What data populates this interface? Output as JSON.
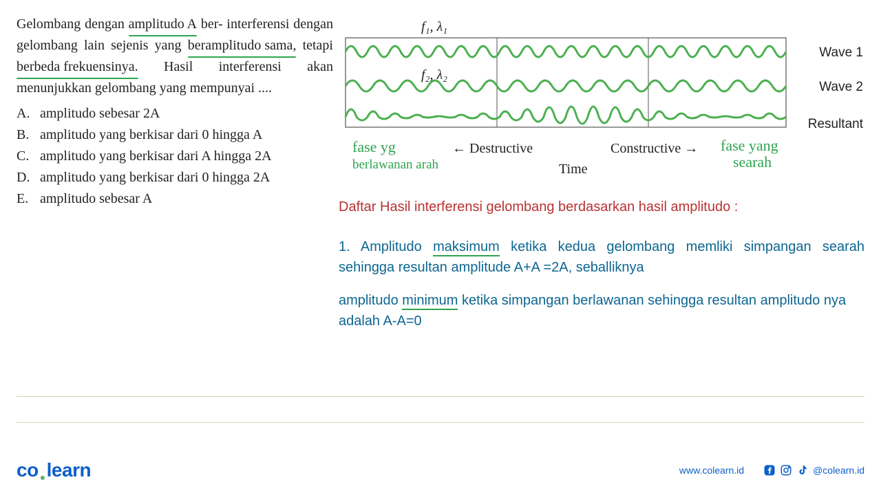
{
  "question": {
    "pre1": "Gelombang dengan ",
    "u1": "amplitudo A",
    "mid1": " ber- interferensi dengan gelombang lain sejenis yang ",
    "u2": "beramplitudo sama,",
    "mid2": " tetapi ",
    "u3": "berbeda frekuensinya.",
    "mid3": " Hasil interferensi akan menunjukkan gelombang yang mempunyai ...."
  },
  "options": {
    "a_l": "A.",
    "a_t": "amplitudo sebesar 2A",
    "b_l": "B.",
    "b_t": "amplitudo yang berkisar dari 0 hingga A",
    "c_l": "C.",
    "c_t": "amplitudo yang berkisar dari A hingga 2A",
    "d_l": "D.",
    "d_t": "amplitudo yang berkisar dari 0 hingga 2A",
    "e_l": "E.",
    "e_t": "amplitudo sebesar A"
  },
  "diagram": {
    "f1": "f₁, λ₁",
    "f2": "f₂, λ₂",
    "wave1": "Wave 1",
    "wave2": "Wave 2",
    "resultant": "Resultant",
    "destructive": "Destructive",
    "constructive": "Constructive",
    "time": "Time"
  },
  "handwrite": {
    "hw1a": "fase yg",
    "hw1b": "berlawanan arah",
    "hw2a": "fase yang",
    "hw2b": "searah"
  },
  "explanation": {
    "header": "Daftar Hasil interferensi gelombang berdasarkan hasil amplitudo :",
    "p1a": "1. Amplitudo ",
    "p1u": "maksimum",
    "p1b": " ketika kedua gelombang memliki simpangan searah sehingga resultan amplitude A+A =2A, seballiknya",
    "p2a": "amplitudo ",
    "p2u": "minimum",
    "p2b": " ketika simpangan berlawanan sehingga resultan amplitudo nya adalah A-A=0"
  },
  "footer": {
    "logo_co": "co",
    "logo_learn": "learn",
    "url": "www.colearn.id",
    "handle": "@colearn.id"
  }
}
